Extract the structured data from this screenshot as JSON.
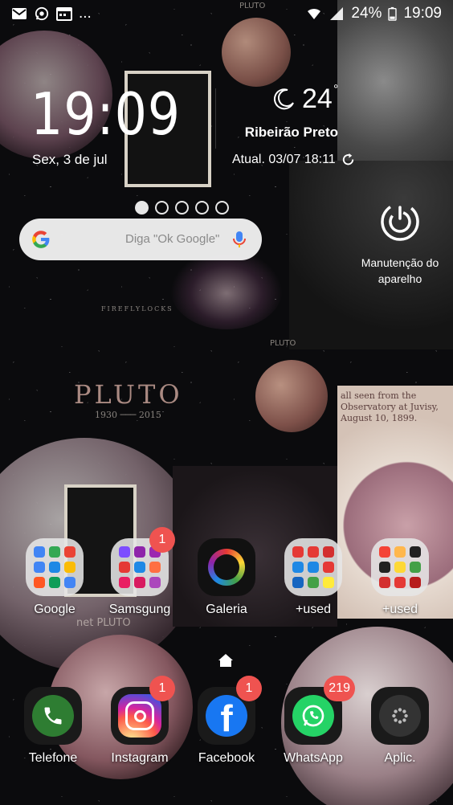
{
  "status_bar": {
    "left_icons": [
      "gmail-icon",
      "whatsapp-icon",
      "calendar-icon"
    ],
    "more": "...",
    "battery": "24%",
    "time": "19:09"
  },
  "clock": {
    "time": "19:09",
    "date": "Sex, 3 de jul"
  },
  "weather": {
    "temperature": "24",
    "degree": "°",
    "city": "Ribeirão Preto",
    "updated": "Atual. 03/07 18:11",
    "icon": "moon-icon"
  },
  "search": {
    "placeholder": "Diga \"Ok Google\""
  },
  "maintenance": {
    "label": "Manutenção do aparelho",
    "icon": "power-cycle-icon"
  },
  "apps_row1": [
    {
      "label": "Google",
      "badge": ""
    },
    {
      "label": "Samsgung",
      "badge": "1"
    },
    {
      "label": "Galeria",
      "badge": ""
    },
    {
      "label": "+used",
      "badge": ""
    },
    {
      "label": "+used",
      "badge": ""
    }
  ],
  "dock": [
    {
      "label": "Telefone",
      "badge": ""
    },
    {
      "label": "Instagram",
      "badge": "1"
    },
    {
      "label": "Facebook",
      "badge": "1"
    },
    {
      "label": "WhatsApp",
      "badge": "219"
    },
    {
      "label": "Aplic.",
      "badge": ""
    }
  ],
  "wallpaper_text": {
    "pluto_big": "PLUTO",
    "years": "1930 ─── 2015",
    "pluto_small_1": "PLUTO",
    "pluto_small_2": "PLUTO",
    "net_pluto": "net PLUTO",
    "fireflylocks": "FIREFLYLOCKS",
    "observatory": "all seen from the Observatory at Juvisy, August 10, 1899."
  },
  "colors": {
    "badge": "#ef5350",
    "instagram": "#d6249f",
    "facebook": "#1877f2",
    "whatsapp": "#25d366",
    "phone": "#2e7d32"
  }
}
